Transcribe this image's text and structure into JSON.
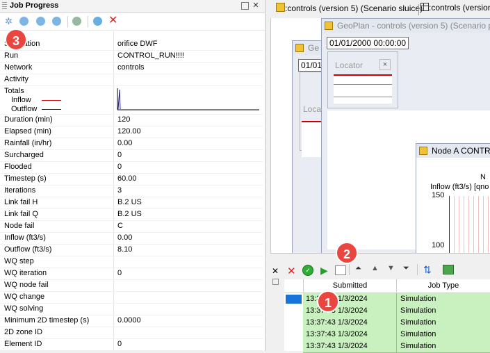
{
  "job_progress": {
    "title": "Job Progress",
    "properties": [
      {
        "label": "Simulation",
        "value": "orifice DWF"
      },
      {
        "label": "Run",
        "value": "CONTROL_RUN!!!!"
      },
      {
        "label": "Network",
        "value": "controls"
      },
      {
        "label": "Activity",
        "value": ""
      },
      {
        "label": "Totals",
        "value": ""
      },
      {
        "label": "Duration (min)",
        "value": "120"
      },
      {
        "label": "Elapsed (min)",
        "value": "120.00"
      },
      {
        "label": "Rainfall (in/hr)",
        "value": "0.00"
      },
      {
        "label": "Surcharged",
        "value": "0"
      },
      {
        "label": "Flooded",
        "value": "0"
      },
      {
        "label": "Timestep (s)",
        "value": "60.00"
      },
      {
        "label": "Iterations",
        "value": "3"
      },
      {
        "label": "Link fail H",
        "value": "B.2 US"
      },
      {
        "label": "Link fail Q",
        "value": "B.2 US"
      },
      {
        "label": "Node fail",
        "value": "C"
      },
      {
        "label": "Inflow (ft3/s)",
        "value": "0.00"
      },
      {
        "label": "Outflow (ft3/s)",
        "value": "8.10"
      },
      {
        "label": "WQ step",
        "value": ""
      },
      {
        "label": "WQ iteration",
        "value": "0"
      },
      {
        "label": "WQ node fail",
        "value": ""
      },
      {
        "label": "WQ change",
        "value": ""
      },
      {
        "label": "WQ solving",
        "value": ""
      },
      {
        "label": "Minimum 2D timestep (s)",
        "value": "0.0000"
      },
      {
        "label": "2D zone ID",
        "value": ""
      },
      {
        "label": "Element ID",
        "value": "0"
      }
    ],
    "totals_legend": {
      "inflow": "Inflow",
      "outflow": "Outflow",
      "inflow_color": "#d01010",
      "outflow_color": "#202080"
    }
  },
  "tabs": [
    {
      "label": ":controls (version 5) (Scenario sluice)"
    },
    {
      "label": ":controls (version"
    }
  ],
  "geoplan": {
    "title": "GeoPlan - controls (version 5) (Scenario p",
    "date": "01/01/2000 00:00:00",
    "locator": "Locator",
    "back_date": "01/01",
    "back_title": "Ge",
    "back_locator": "Loca"
  },
  "node_window": {
    "title": "Node A CONTR",
    "series_label": "Inflow (ft3/s) [qno",
    "y_tick_top": "150",
    "y_tick_mid": "100",
    "corner_letter": "N"
  },
  "job_queue": {
    "columns": [
      "Submitted",
      "Job Type"
    ],
    "rows": [
      {
        "submitted": "13:37:43 1/3/2024",
        "job_type": "Simulation"
      },
      {
        "submitted": "13:37:43 1/3/2024",
        "job_type": "Simulation"
      },
      {
        "submitted": "13:37:43 1/3/2024",
        "job_type": "Simulation"
      },
      {
        "submitted": "13:37:43 1/3/2024",
        "job_type": "Simulation"
      },
      {
        "submitted": "13:37:43 1/3/2024",
        "job_type": "Simulation"
      }
    ]
  },
  "badges": [
    "3",
    "2",
    "1"
  ]
}
